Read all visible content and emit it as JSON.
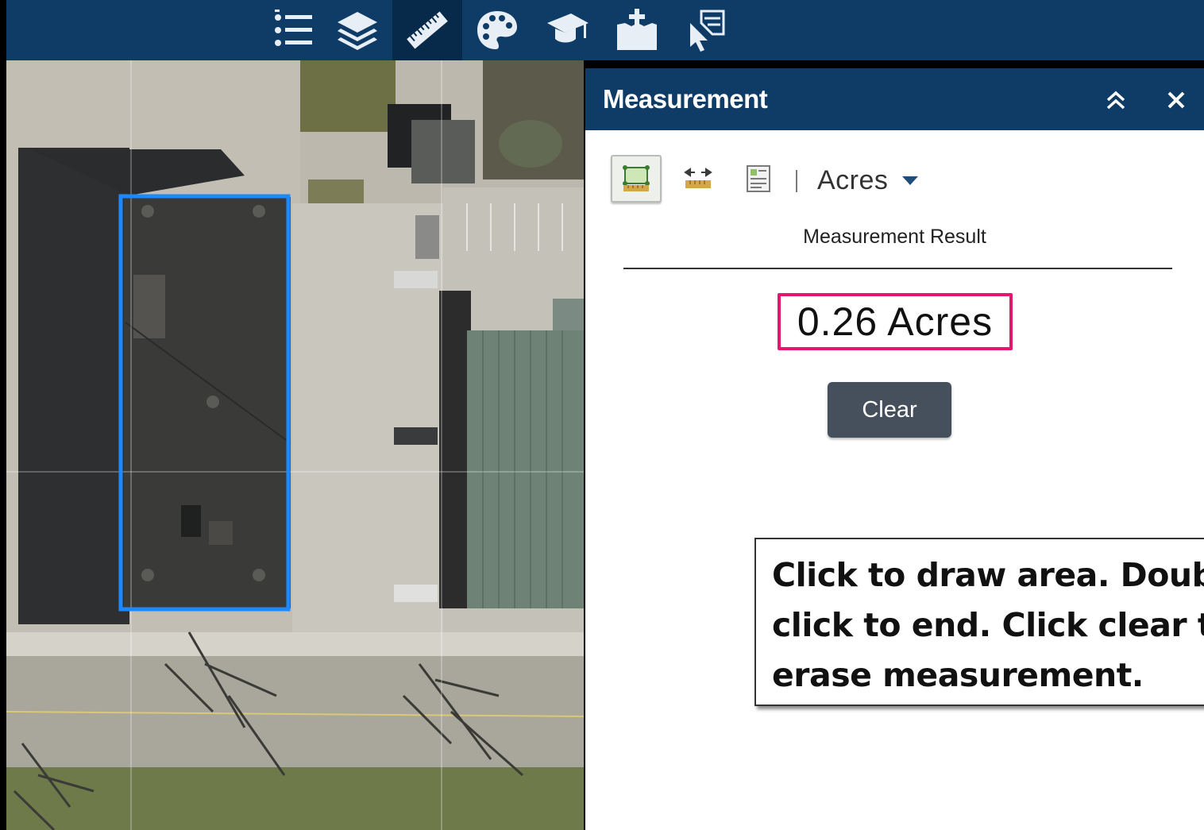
{
  "toolbar": {
    "tools": [
      {
        "icon": "legend-list-icon",
        "active": false
      },
      {
        "icon": "layers-icon",
        "active": false
      },
      {
        "icon": "ruler-measure-icon",
        "active": true
      },
      {
        "icon": "basemap-palette-icon",
        "active": false
      },
      {
        "icon": "education-cap-icon",
        "active": false
      },
      {
        "icon": "add-data-icon",
        "active": false
      },
      {
        "icon": "select-tool-icon",
        "active": false
      }
    ],
    "colors": {
      "background": "#0f3c66",
      "active": "#082a4a"
    }
  },
  "map": {
    "selection_color": "#1e88ff"
  },
  "panel": {
    "title": "Measurement",
    "tools": [
      "area-measure-icon",
      "distance-measure-icon",
      "location-measure-icon"
    ],
    "active_tool": "area-measure-icon",
    "unit": "Acres",
    "result_label": "Measurement Result",
    "result_value": "0.26 Acres",
    "clear_label": "Clear",
    "highlight_color": "#e5166f"
  },
  "callout": {
    "lines": [
      "Click to draw area. Double",
      "click to end. Click clear to",
      "erase measurement."
    ]
  }
}
